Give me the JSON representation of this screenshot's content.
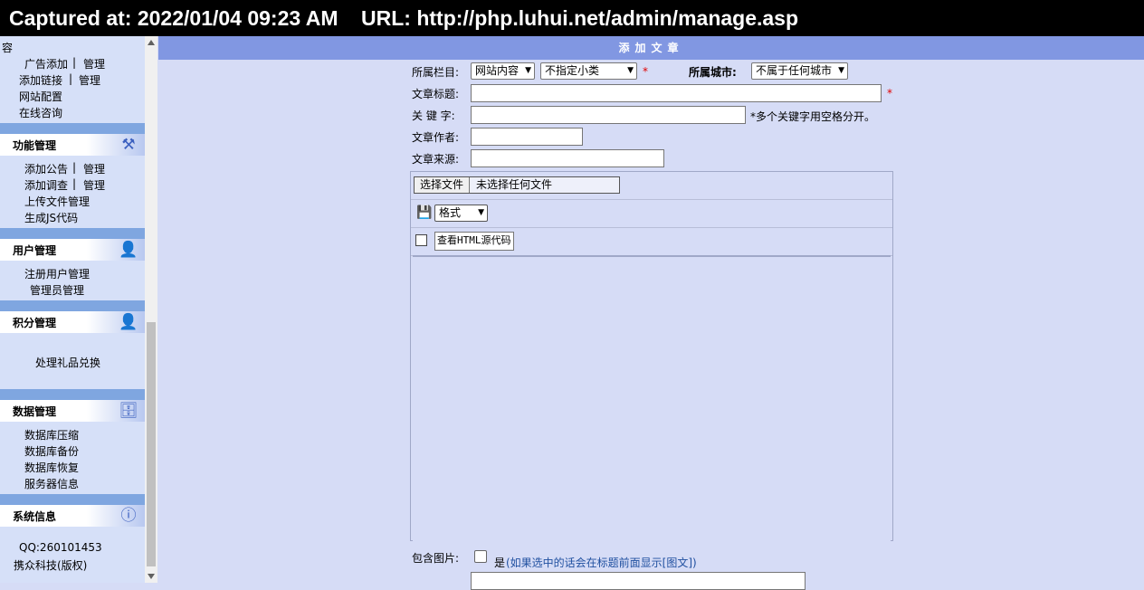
{
  "caption": "Captured at: 2022/01/04 09:23 AM    URL: http://php.luhui.net/admin/manage.asp",
  "sidebar": {
    "truncated_top": "容",
    "content_links": {
      "ad_add": "广告添加",
      "ad_manage": "管理",
      "link_add": "添加链接",
      "link_manage": "管理",
      "site_config": "网站配置",
      "online_consult": "在线咨询"
    },
    "function_mgmt": {
      "title": "功能管理",
      "icon": "tools-icon",
      "notice_add": "添加公告",
      "notice_manage": "管理",
      "survey_add": "添加调查",
      "survey_manage": "管理",
      "upload_manage": "上传文件管理",
      "gen_js": "生成JS代码"
    },
    "user_mgmt": {
      "title": "用户管理",
      "icon": "user-icon",
      "registered_users": "注册用户管理",
      "admins": "管理员管理"
    },
    "points_mgmt": {
      "title": "积分管理",
      "icon": "user-icon",
      "gift_exchange": "处理礼品兑换"
    },
    "data_mgmt": {
      "title": "数据管理",
      "icon": "database-icon",
      "compress": "数据库压缩",
      "backup": "数据库备份",
      "restore": "数据库恢复",
      "server_info": "服务器信息"
    },
    "system_info": {
      "title": "系统信息",
      "icon": "info-icon",
      "qq": "QQ:260101453",
      "copyright": "携众科技(版权)"
    }
  },
  "main": {
    "title": "添加文章",
    "column_label": "所属栏目:",
    "column_select": "网站内容",
    "subcategory_select": "不指定小类",
    "required_mark": "*",
    "city_label": "所属城市:",
    "city_select": "不属于任何城市",
    "title_label": "文章标题:",
    "keyword_label": "关 键 字:",
    "keyword_hint": "*多个关键字用空格分开。",
    "author_label": "文章作者:",
    "source_label": "文章来源:",
    "file_button": "选择文件",
    "file_status": "未选择任何文件",
    "format_select": "格式",
    "view_html_button": "查看HTML源代码",
    "include_image_label": "包含图片:",
    "include_image_yes": "是",
    "include_image_hint": "(如果选中的话会在标题前面显示[图文])"
  }
}
